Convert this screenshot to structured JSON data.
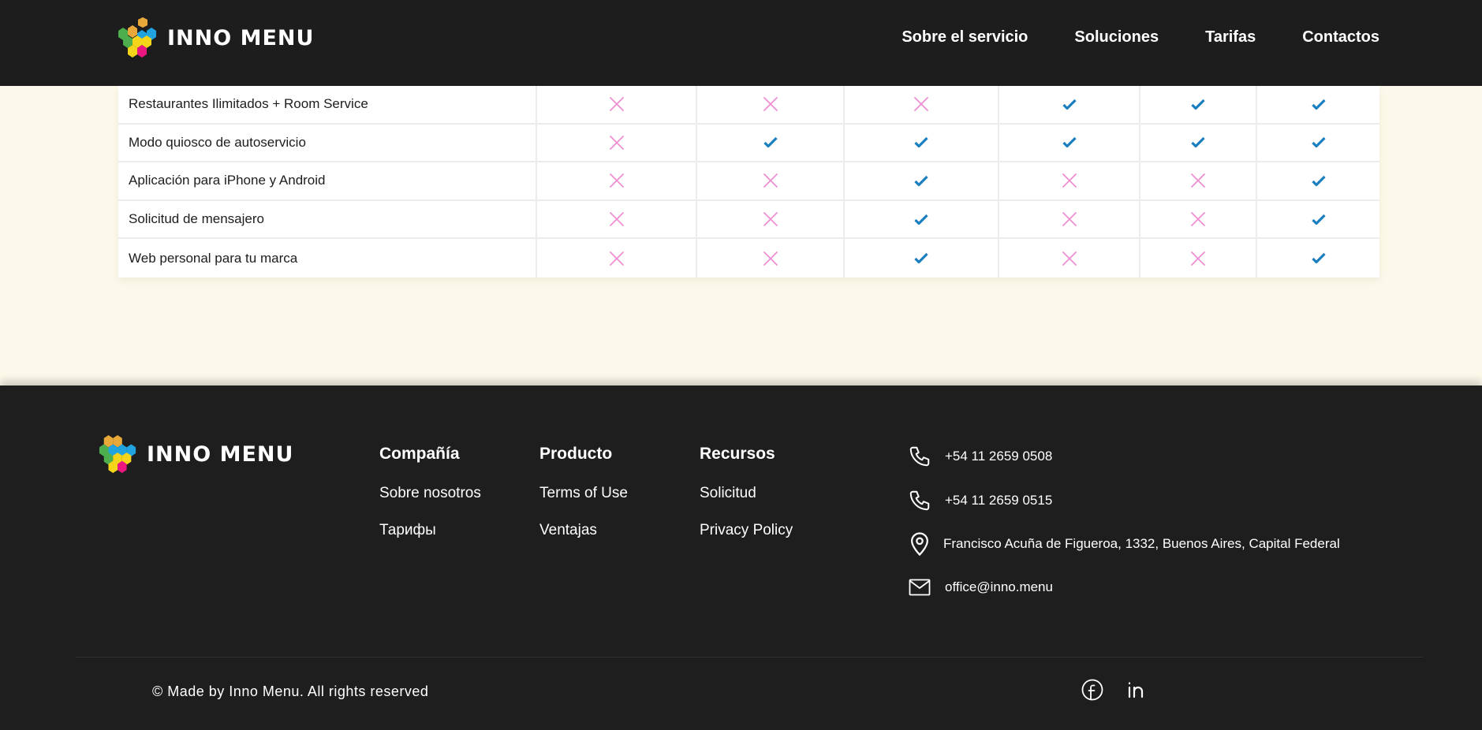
{
  "header": {
    "logo_text": "INNO MENU",
    "nav": [
      "Sobre el servicio",
      "Soluciones",
      "Tarifas",
      "Contactos"
    ]
  },
  "table": {
    "rows": [
      {
        "feature": "Restaurantes Ilimitados + Room Service",
        "values": [
          false,
          false,
          false,
          true,
          true,
          true
        ]
      },
      {
        "feature": "Modo quiosco de autoservicio",
        "values": [
          false,
          true,
          true,
          true,
          true,
          true
        ]
      },
      {
        "feature": "Aplicación para iPhone y Android",
        "values": [
          false,
          false,
          true,
          false,
          false,
          true
        ]
      },
      {
        "feature": "Solicitud de mensajero",
        "values": [
          false,
          false,
          true,
          false,
          false,
          true
        ]
      },
      {
        "feature": "Web personal para tu marca",
        "values": [
          false,
          false,
          true,
          false,
          false,
          true
        ]
      }
    ]
  },
  "footer": {
    "logo_text": "INNO MENU",
    "columns": [
      {
        "title": "Compañía",
        "links": [
          "Sobre nosotros",
          "Тарифы"
        ]
      },
      {
        "title": "Producto",
        "links": [
          "Terms of Use",
          "Ventajas"
        ]
      },
      {
        "title": "Recursos",
        "links": [
          "Solicitud",
          "Privacy Policy"
        ]
      }
    ],
    "contacts": {
      "phone1": "+54 11 2659 0508",
      "phone2": "+54 11 2659 0515",
      "address": "Francisco Acuña de Figueroa, 1332, Buenos Aires, Capital Federal",
      "email": "office@inno.menu"
    },
    "copyright": "© Made by Inno Menu. All rights reserved",
    "social_icons": [
      "facebook-icon",
      "linkedin-icon"
    ]
  },
  "colors": {
    "header_bg": "#1d1d1e",
    "page_bg": "#fdf9ea",
    "check": "#1a7fbf",
    "cross": "#ee8fd2",
    "logo_hex": [
      "#e8a83a",
      "#21a3e0",
      "#4cae4c",
      "#f4d51a",
      "#e9177f"
    ]
  }
}
